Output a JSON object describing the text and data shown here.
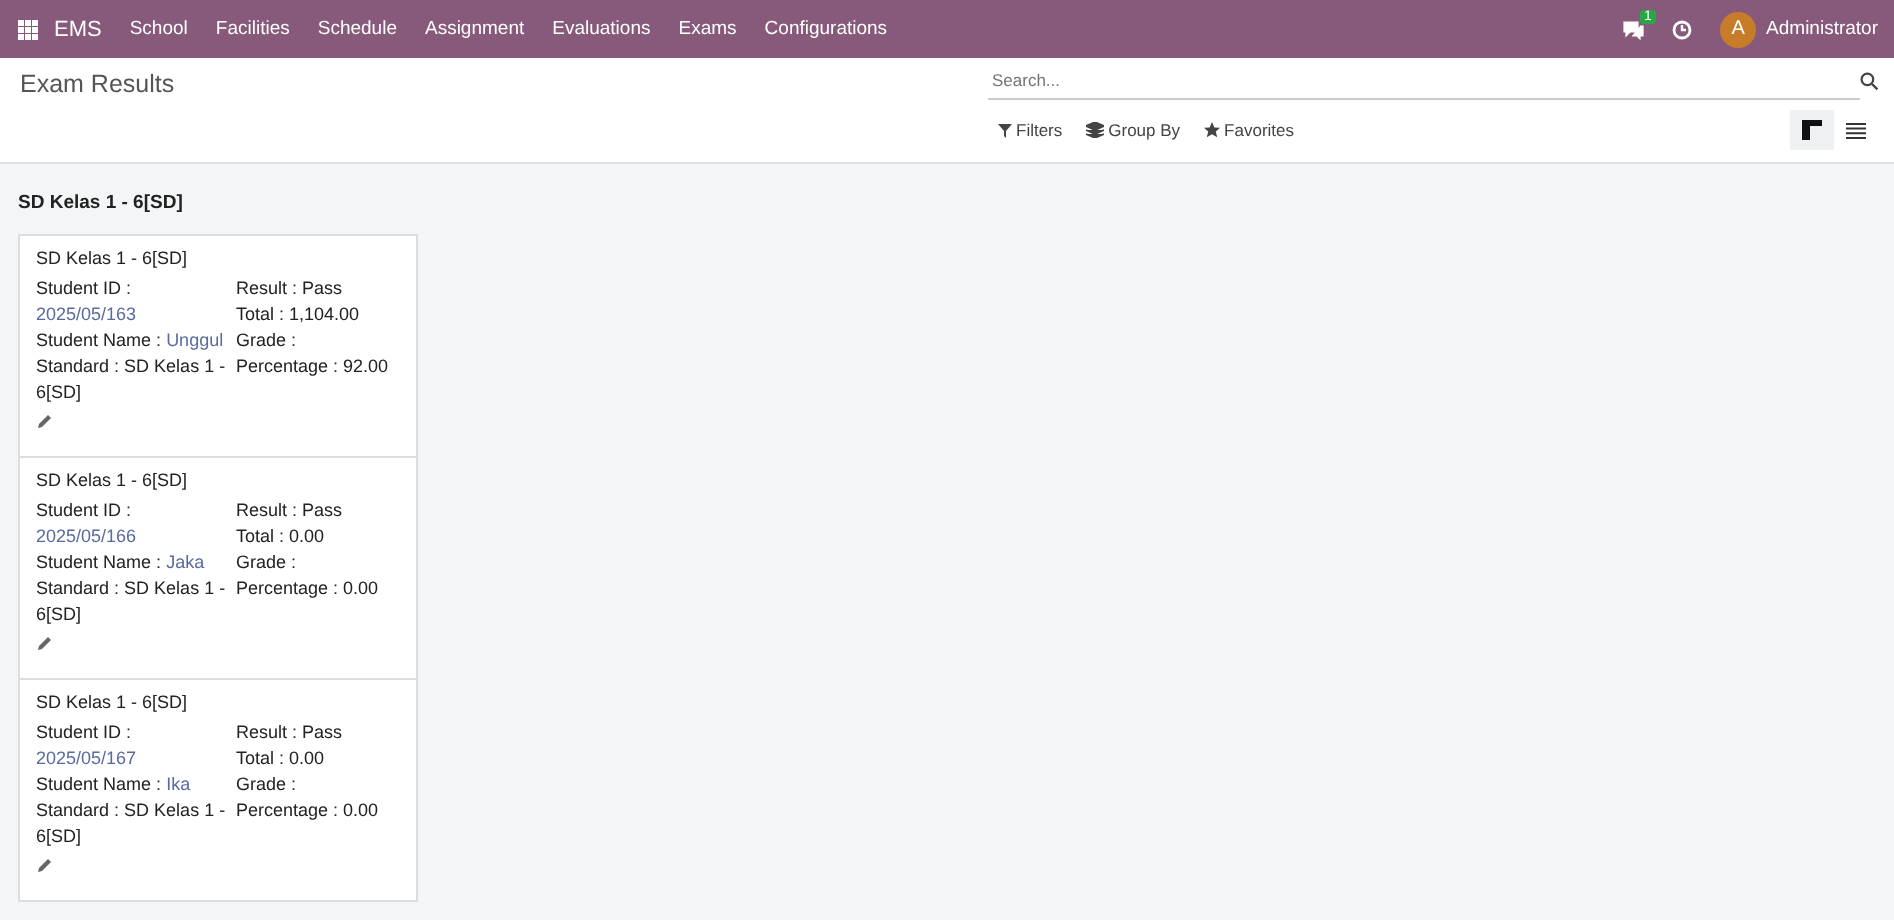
{
  "navbar": {
    "app": "EMS",
    "menu": [
      "School",
      "Facilities",
      "Schedule",
      "Assignment",
      "Evaluations",
      "Exams",
      "Configurations"
    ],
    "message_count": "1",
    "avatar": "A",
    "user": "Administrator"
  },
  "title": "Exam Results",
  "search": {
    "placeholder": "Search..."
  },
  "filters": [
    "Filters",
    "Group By",
    "Favorites"
  ],
  "views": [
    {
      "kind": "kanban",
      "selected": true
    },
    {
      "kind": "list",
      "selected": false
    }
  ],
  "group": {
    "title": "SD Kelas 1 - 6[SD]",
    "cards": [
      {
        "title": "SD Kelas 1 - 6[SD]",
        "left": [
          {
            "label": "Student ID :",
            "value": "2025/05/163",
            "linked": true
          },
          {
            "label": "Student Name :",
            "value": "Unggul",
            "linked": true
          },
          {
            "label": "Standard :",
            "value": "SD Kelas 1 - 6[SD]",
            "linked": false
          }
        ],
        "right": [
          "Result : Pass",
          "Total : 1,104.00",
          "Grade :",
          "Percentage : 92.00"
        ]
      },
      {
        "title": "SD Kelas 1 - 6[SD]",
        "left": [
          {
            "label": "Student ID :",
            "value": "2025/05/166",
            "linked": true
          },
          {
            "label": "Student Name :",
            "value": "Jaka",
            "linked": true
          },
          {
            "label": "Standard :",
            "value": "SD Kelas 1 - 6[SD]",
            "linked": false
          }
        ],
        "right": [
          "Result : Pass",
          "Total : 0.00",
          "Grade :",
          "Percentage : 0.00"
        ]
      },
      {
        "title": "SD Kelas 1 - 6[SD]",
        "left": [
          {
            "label": "Student ID :",
            "value": "2025/05/167",
            "linked": true
          },
          {
            "label": "Student Name :",
            "value": "Ika",
            "linked": true
          },
          {
            "label": "Standard :",
            "value": "SD Kelas 1 - 6[SD]",
            "linked": false
          }
        ],
        "right": [
          "Result : Pass",
          "Total : 0.00",
          "Grade :",
          "Percentage : 0.00"
        ]
      }
    ]
  }
}
